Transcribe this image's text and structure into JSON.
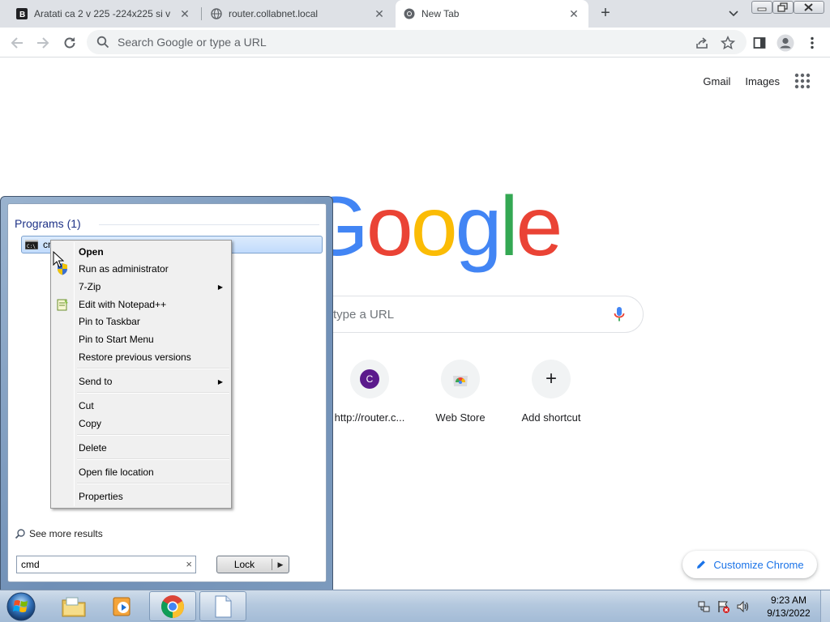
{
  "browser": {
    "tabs": [
      {
        "title": "Aratati ca 2 v 225 -224x225 si v",
        "close": "✕",
        "active": false
      },
      {
        "title": "router.collabnet.local",
        "close": "✕",
        "active": false
      },
      {
        "title": "New Tab",
        "close": "✕",
        "active": true
      }
    ],
    "new_tab_label": "+",
    "omnibox": {
      "placeholder": "Search Google or type a URL"
    }
  },
  "ntp": {
    "links": {
      "gmail": "Gmail",
      "images": "Images"
    },
    "logo_letters": [
      {
        "char": "G",
        "color": "#4285f4"
      },
      {
        "char": "o",
        "color": "#ea4335"
      },
      {
        "char": "o",
        "color": "#fbbc05"
      },
      {
        "char": "g",
        "color": "#4285f4"
      },
      {
        "char": "l",
        "color": "#34a853"
      },
      {
        "char": "e",
        "color": "#ea4335"
      }
    ],
    "search_placeholder": "type a URL",
    "shortcuts": [
      {
        "label": "http://router.c...",
        "icon": "C"
      },
      {
        "label": "Web Store",
        "icon": "webstore-icon"
      },
      {
        "label": "Add shortcut",
        "icon": "+"
      }
    ],
    "customize_label": "Customize Chrome"
  },
  "start_menu": {
    "programs_heading": "Programs (1)",
    "result_label": "cmd",
    "see_more": "See more results",
    "search_value": "cmd",
    "clear_glyph": "×",
    "lock_label": "Lock",
    "lock_arrow": "▶"
  },
  "context_menu": {
    "items": [
      {
        "label": "Open",
        "bold": true
      },
      {
        "label": "Run as administrator"
      },
      {
        "label": "7-Zip",
        "submenu": true
      },
      {
        "label": "Edit with Notepad++"
      },
      {
        "label": "Pin to Taskbar"
      },
      {
        "label": "Pin to Start Menu"
      },
      {
        "label": "Restore previous versions"
      },
      {
        "label": "Send to",
        "submenu": true
      },
      {
        "label": "Cut"
      },
      {
        "label": "Copy"
      },
      {
        "label": "Delete"
      },
      {
        "label": "Open file location"
      },
      {
        "label": "Properties"
      }
    ],
    "submenu_arrow": "▶"
  },
  "taskbar": {
    "clock_time": "9:23 AM",
    "clock_date": "9/13/2022"
  },
  "colors": {
    "chrome_tabstrip": "#dee1e6",
    "link_blue": "#1a73e8",
    "win7_heading": "#1e3287"
  }
}
